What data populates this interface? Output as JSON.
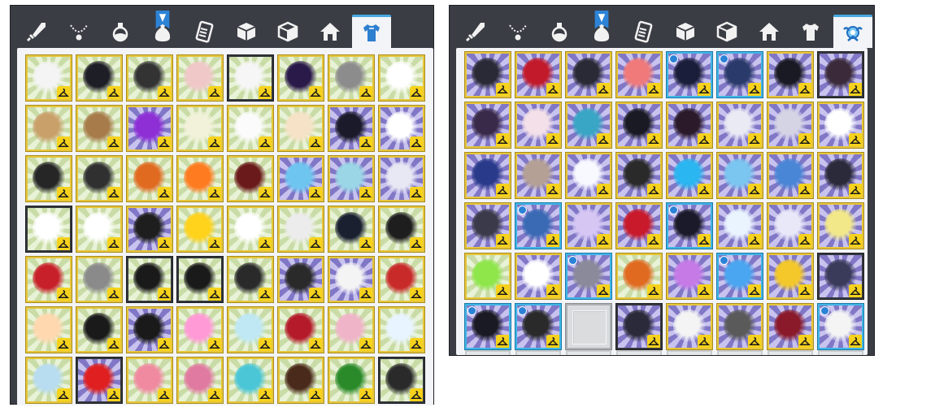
{
  "accent_color": "#46a8e0",
  "left_panel": {
    "tabs": [
      "sword-icon",
      "necklace-icon",
      "potion-icon",
      "bag-icon",
      "scroll-icon",
      "box-icon",
      "box-open-icon",
      "house-icon",
      "shirt-icon"
    ],
    "active_tab": 8,
    "bookmark_tab": 3,
    "grid": [
      [
        [
          "g",
          "#f4f4f4",
          "y"
        ],
        [
          "g",
          "#1e1e26",
          "y"
        ],
        [
          "g",
          "#333333",
          "y"
        ],
        [
          "g",
          "#f0c8c8",
          "y"
        ],
        [
          "g",
          "#f6f6f6",
          "d"
        ],
        [
          "g",
          "#2a1a4a",
          "y"
        ],
        [
          "g",
          "#8c8c8c",
          "y"
        ],
        [
          "g",
          "#ffffff",
          "y"
        ]
      ],
      [
        [
          "g",
          "#c9a06a",
          "y"
        ],
        [
          "g",
          "#a77b4a",
          "y"
        ],
        [
          "p",
          "#8e2fd6",
          "y"
        ],
        [
          "g",
          "#f2f2da",
          "y"
        ],
        [
          "g",
          "#fbfbfb",
          "y"
        ],
        [
          "g",
          "#f6e3c7",
          "y"
        ],
        [
          "p",
          "#1a1a2a",
          "y"
        ],
        [
          "p",
          "#ffffff",
          "y"
        ]
      ],
      [
        [
          "g",
          "#262626",
          "y"
        ],
        [
          "g",
          "#303030",
          "y"
        ],
        [
          "g",
          "#e06a20",
          "y"
        ],
        [
          "g",
          "#ff7b20",
          "y"
        ],
        [
          "g",
          "#6a1a1a",
          "y"
        ],
        [
          "p",
          "#6ec6f0",
          "y"
        ],
        [
          "p",
          "#9ad6e6",
          "y"
        ],
        [
          "p",
          "#e8e8f4",
          "y"
        ]
      ],
      [
        [
          "g",
          "#ffffff",
          "d"
        ],
        [
          "g",
          "#ffffff",
          "y"
        ],
        [
          "p",
          "#1e1e1e",
          "y"
        ],
        [
          "g",
          "#ffd21c",
          "y"
        ],
        [
          "g",
          "#ffffff",
          "y"
        ],
        [
          "g",
          "#ececec",
          "y"
        ],
        [
          "g",
          "#1a2030",
          "y"
        ],
        [
          "g",
          "#1e1e1e",
          "y"
        ]
      ],
      [
        [
          "g",
          "#c8202a",
          "y"
        ],
        [
          "g",
          "#8a8a8a",
          "y"
        ],
        [
          "g",
          "#1a1a1a",
          "d"
        ],
        [
          "g",
          "#1a1a1a",
          "d"
        ],
        [
          "g",
          "#2a2a2a",
          "y"
        ],
        [
          "p",
          "#2a2a2a",
          "y"
        ],
        [
          "p",
          "#f4f4f4",
          "y"
        ],
        [
          "g",
          "#c82a2a",
          "y"
        ]
      ],
      [
        [
          "g",
          "#ffd8b0",
          "y"
        ],
        [
          "g",
          "#1a1a1a",
          "y"
        ],
        [
          "p",
          "#1a1a1a",
          "y"
        ],
        [
          "g",
          "#ff9ad6",
          "y"
        ],
        [
          "g",
          "#bfe8f4",
          "y"
        ],
        [
          "g",
          "#b41a2a",
          "y"
        ],
        [
          "g",
          "#f0b4c8",
          "y"
        ],
        [
          "g",
          "#e8f4ff",
          "y"
        ]
      ],
      [
        [
          "g",
          "#b8dcf0",
          "y"
        ],
        [
          "p",
          "#e02020",
          "d"
        ],
        [
          "g",
          "#f08aa0",
          "y"
        ],
        [
          "g",
          "#e07aa0",
          "y"
        ],
        [
          "g",
          "#4ac6d6",
          "y"
        ],
        [
          "g",
          "#4a2a1a",
          "y"
        ],
        [
          "g",
          "#2a8a2a",
          "y"
        ],
        [
          "g",
          "#2a2a2a",
          "d"
        ]
      ]
    ]
  },
  "right_panel": {
    "tabs": [
      "sword-icon",
      "necklace-icon",
      "potion-icon",
      "bag-icon",
      "scroll-icon",
      "box-icon",
      "box-open-icon",
      "house-icon",
      "shirt-icon",
      "wing-emblem-icon"
    ],
    "active_tab": 9,
    "bookmark_tab": 3,
    "grid": [
      [
        [
          "p",
          "#2a2a36",
          "y"
        ],
        [
          "p",
          "#c21a2a",
          "y"
        ],
        [
          "p",
          "#2a2a36",
          "y"
        ],
        [
          "p",
          "#f07a7a",
          "y"
        ],
        [
          "b",
          "#1a1e3a",
          "b"
        ],
        [
          "b",
          "#2a3a6a",
          "b"
        ],
        [
          "p",
          "#1a1a24",
          "y"
        ],
        [
          "p",
          "#3a2a3a",
          "d"
        ]
      ],
      [
        [
          "p",
          "#3a2a4a",
          "y"
        ],
        [
          "p",
          "#f4e0e8",
          "y"
        ],
        [
          "p",
          "#3aa6c6",
          "y"
        ],
        [
          "p",
          "#1a1a24",
          "y"
        ],
        [
          "p",
          "#2a1a2a",
          "y"
        ],
        [
          "p",
          "#eaeaf4",
          "y"
        ],
        [
          "p",
          "#d4d4e4",
          "y"
        ],
        [
          "p",
          "#ffffff",
          "y"
        ]
      ],
      [
        [
          "p",
          "#2a3a8a",
          "y"
        ],
        [
          "p",
          "#b4a094",
          "y"
        ],
        [
          "p",
          "#f8f8ff",
          "y"
        ],
        [
          "p",
          "#2a2a2a",
          "y"
        ],
        [
          "p",
          "#2ab6f0",
          "y"
        ],
        [
          "p",
          "#7ac6f0",
          "y"
        ],
        [
          "p",
          "#4a86d6",
          "y"
        ],
        [
          "p",
          "#2a2a3a",
          "y"
        ]
      ],
      [
        [
          "p",
          "#3a3a4a",
          "y"
        ],
        [
          "b",
          "#3a6ab4",
          "b"
        ],
        [
          "p",
          "#d6c6f4",
          "y"
        ],
        [
          "p",
          "#c81a2a",
          "y"
        ],
        [
          "b",
          "#1a1a2a",
          "b"
        ],
        [
          "p",
          "#eaf4ff",
          "y"
        ],
        [
          "p",
          "#e8e8f8",
          "y"
        ],
        [
          "p",
          "#f2e88a",
          "y"
        ]
      ],
      [
        [
          "g",
          "#8ee64a",
          "y"
        ],
        [
          "p",
          "#ffffff",
          "y"
        ],
        [
          "b",
          "#8a8a9a",
          "b"
        ],
        [
          "g",
          "#e06a20",
          "y"
        ],
        [
          "p",
          "#c67ae6",
          "y"
        ],
        [
          "b",
          "#4aa6f0",
          "b"
        ],
        [
          "p",
          "#f4c82a",
          "y"
        ],
        [
          "p",
          "#3a3a5a",
          "d"
        ]
      ],
      [
        [
          "b",
          "#1a1a24",
          "b"
        ],
        [
          "b",
          "#2a2a2a",
          "b"
        ],
        [
          "e",
          "",
          ""
        ],
        [
          "p",
          "#2a2a3a",
          "d"
        ],
        [
          "p",
          "#f4f4f4",
          "y"
        ],
        [
          "p",
          "#5a5a5a",
          "y"
        ],
        [
          "p",
          "#8a1a2a",
          "y"
        ],
        [
          "b",
          "#f4f4f4",
          "b"
        ]
      ]
    ]
  }
}
